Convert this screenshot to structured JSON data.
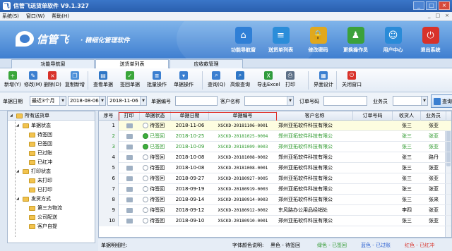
{
  "window": {
    "title": "信管飞送货单软件 V9.1.327",
    "icon_letter": "飞",
    "controls": [
      "_",
      "□",
      "×"
    ]
  },
  "menu": {
    "items": [
      "系统(S)",
      "窗口(W)",
      "帮助(H)"
    ],
    "right_controls": [
      "_",
      "□",
      "×"
    ]
  },
  "banner": {
    "logo_text": "信管飞",
    "slogan": "· 精细化管理软件",
    "nav": [
      {
        "label": "功能导航窗",
        "icon": "home-icon",
        "color": "#2f7fd6",
        "glyph": "⌂"
      },
      {
        "label": "送货单列表",
        "icon": "list-icon",
        "color": "#2b8dd9",
        "glyph": "≡"
      },
      {
        "label": "修改密码",
        "icon": "lock-icon",
        "color": "#e0a81e",
        "glyph": "🔒"
      },
      {
        "label": "更换操作员",
        "icon": "user-switch-icon",
        "color": "#3ba13b",
        "glyph": "♟"
      },
      {
        "label": "用户中心",
        "icon": "user-center-icon",
        "color": "#2a8bd8",
        "glyph": "☺"
      },
      {
        "label": "退出系统",
        "icon": "power-icon",
        "color": "#d8322a",
        "glyph": "⏻"
      }
    ]
  },
  "tabs": [
    {
      "label": "功能导航窗",
      "active": false
    },
    {
      "label": "送货单列表",
      "active": true
    },
    {
      "label": "应收款管理",
      "active": false
    }
  ],
  "toolbar": {
    "buttons": [
      {
        "label": "新增(Y)",
        "icon": "add-icon",
        "color": "#3aa63a",
        "glyph": "+"
      },
      {
        "label": "修改(M)",
        "icon": "edit-icon",
        "color": "#3b7fd0",
        "glyph": "✎"
      },
      {
        "label": "删除(D)",
        "icon": "delete-icon",
        "color": "#d8322a",
        "glyph": "×"
      },
      {
        "label": "复制新增",
        "icon": "copy-icon",
        "color": "#4b8fd8",
        "glyph": "❐"
      },
      {
        "label": "查看单据",
        "icon": "view-icon",
        "color": "#2e76c6",
        "glyph": "▤"
      },
      {
        "label": "签回单据",
        "icon": "signback-icon",
        "color": "#3aa63a",
        "glyph": "✓"
      },
      {
        "label": "批量操作",
        "icon": "batch-icon",
        "color": "#3b7fd0",
        "glyph": "≣"
      },
      {
        "label": "单据操作",
        "icon": "doc-op-icon",
        "color": "#3b7fd0",
        "glyph": "▾"
      },
      {
        "label": "查询(Q)",
        "icon": "query-icon",
        "color": "#3b7fd0",
        "glyph": "⌕"
      },
      {
        "label": "高级查询",
        "icon": "advanced-query-icon",
        "color": "#2e76c6",
        "glyph": "⌕"
      },
      {
        "label": "导出Excel",
        "icon": "excel-icon",
        "color": "#2f9b3c",
        "glyph": "X"
      },
      {
        "label": "打印",
        "icon": "print-icon",
        "color": "#5c6f86",
        "glyph": "⎙"
      },
      {
        "label": "界面设计",
        "icon": "design-icon",
        "color": "#3b7fd0",
        "glyph": "▦"
      },
      {
        "label": "关闭窗口",
        "icon": "close-window-icon",
        "color": "#d8322a",
        "glyph": "⏻"
      }
    ]
  },
  "filters": {
    "date_label": "单据日期",
    "date_range_select": "最近3个月",
    "date_from": "2018-08-06",
    "date_to": "2018-11-06",
    "doc_no_label": "单据编号",
    "doc_no_value": "",
    "customer_label": "客户名称",
    "customer_value": "",
    "order_no_label": "订单号码",
    "order_no_value": "",
    "salesperson_label": "业务员",
    "salesperson_value": "",
    "query_button": "查询"
  },
  "tree": {
    "root": "所有送货单",
    "groups": [
      {
        "label": "单据状态",
        "children": [
          "待签回",
          "已签回",
          "已过账",
          "已红冲"
        ]
      },
      {
        "label": "打印状态",
        "children": [
          "未打印",
          "已打印"
        ]
      },
      {
        "label": "发货方式",
        "children": [
          "第三方物流",
          "公司配送",
          "客户自提"
        ]
      }
    ]
  },
  "grid": {
    "columns": [
      "序号",
      "打印",
      "单据状态",
      "单据日期",
      "单据编号",
      "客户名称",
      "订单号码",
      "收货人",
      "业务员"
    ],
    "rows": [
      {
        "no": "1",
        "status_green": false,
        "status": "待签回",
        "date": "2018-11-06",
        "code": "XSCKD-20181106-0001",
        "customer": "郑州亚拓软件科技有限公",
        "order": "",
        "receiver": "张三",
        "salesperson": "张亚",
        "color": "#000000",
        "selected": true
      },
      {
        "no": "2",
        "status_green": true,
        "status": "已签回",
        "date": "2018-10-25",
        "code": "XSCKD-20181025-0004",
        "customer": "郑州亚拓软件科技有限公",
        "order": "",
        "receiver": "张三",
        "salesperson": "张亚",
        "color": "#2f9a2f",
        "selected": false
      },
      {
        "no": "3",
        "status_green": true,
        "status": "已签回",
        "date": "2018-10-09",
        "code": "XSCKD-20181009-0003",
        "customer": "郑州亚拓软件科技有限公",
        "order": "",
        "receiver": "张三",
        "salesperson": "张亚",
        "color": "#2f9a2f",
        "selected": false
      },
      {
        "no": "4",
        "status_green": false,
        "status": "待签回",
        "date": "2018-10-08",
        "code": "XSCKD-20181008-0002",
        "customer": "郑州亚拓软件科技有限公",
        "order": "",
        "receiver": "张三",
        "salesperson": "路丹",
        "color": "#000000",
        "selected": false
      },
      {
        "no": "5",
        "status_green": false,
        "status": "待签回",
        "date": "2018-10-08",
        "code": "XSCKD-20181008-0001",
        "customer": "郑州亚拓软件科技有限公",
        "order": "",
        "receiver": "张三",
        "salesperson": "张亚",
        "color": "#000000",
        "selected": false
      },
      {
        "no": "6",
        "status_green": false,
        "status": "待签回",
        "date": "2018-09-27",
        "code": "XSCKD-20180927-0005",
        "customer": "郑州亚拓软件科技有限公",
        "order": "",
        "receiver": "张三",
        "salesperson": "张亚",
        "color": "#000000",
        "selected": false
      },
      {
        "no": "7",
        "status_green": false,
        "status": "待签回",
        "date": "2018-09-19",
        "code": "XSCKD-20180919-0003",
        "customer": "郑州亚拓软件科技有限公",
        "order": "",
        "receiver": "张三",
        "salesperson": "张亚",
        "color": "#000000",
        "selected": false
      },
      {
        "no": "8",
        "status_green": false,
        "status": "待签回",
        "date": "2018-09-14",
        "code": "XSCKD-20180914-0003",
        "customer": "郑州亚拓软件科技有限公",
        "order": "",
        "receiver": "张三",
        "salesperson": "张来",
        "color": "#000000",
        "selected": false
      },
      {
        "no": "9",
        "status_green": false,
        "status": "待签回",
        "date": "2018-09-12",
        "code": "XSCKD-20180912-0002",
        "customer": "东风路办公用品经销处",
        "order": "",
        "receiver": "李四",
        "salesperson": "张亚",
        "color": "#000000",
        "selected": false
      },
      {
        "no": "10",
        "status_green": false,
        "status": "待签回",
        "date": "2018-09-10",
        "code": "XSCKD-20180910-0001",
        "customer": "郑州亚拓软件科技有限公",
        "order": "",
        "receiver": "张三",
        "salesperson": "张亚",
        "color": "#000000",
        "selected": false
      }
    ]
  },
  "statusbar": {
    "label": "单据明细栏:",
    "legend_prefix": "字体颜色说明:",
    "legend": [
      {
        "text": "黑色 - 待签回",
        "color": "#000000"
      },
      {
        "text": "绿色 - 已签回",
        "color": "#2f9a2f"
      },
      {
        "text": "蓝色 - 已过账",
        "color": "#2a5fd0"
      },
      {
        "text": "红色 - 已红冲",
        "color": "#d8322a"
      }
    ]
  },
  "colors": {
    "title_bar": "#2a5fae",
    "banner": "#3f7fd0",
    "highlight_box": "#e0302a",
    "selected_row": "#fdfde0"
  }
}
